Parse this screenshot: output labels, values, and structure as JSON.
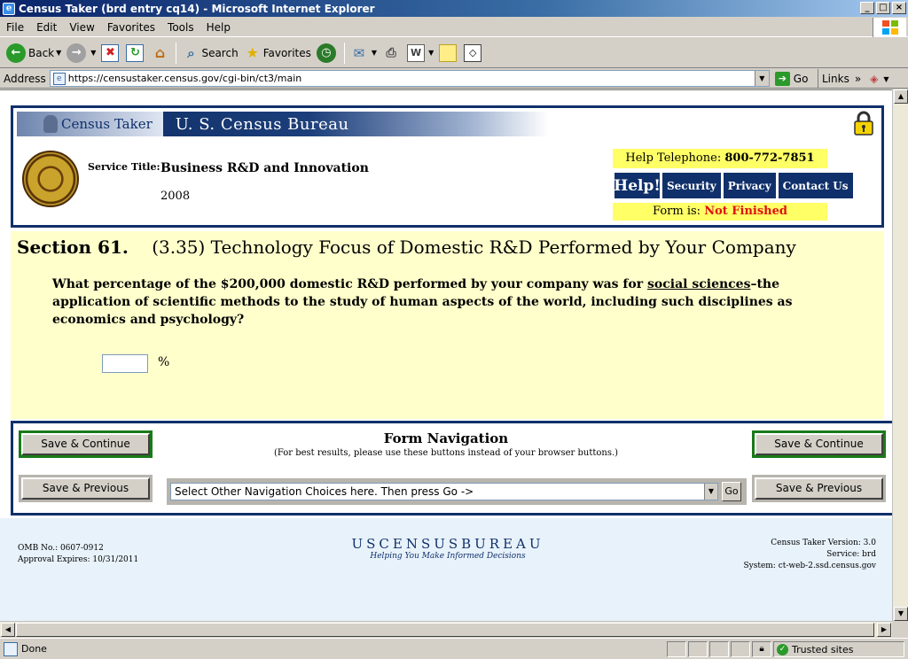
{
  "window": {
    "title": "Census Taker (brd entry cq14) - Microsoft Internet Explorer",
    "minimize": "_",
    "maximize": "□",
    "close": "×"
  },
  "menu": [
    "File",
    "Edit",
    "View",
    "Favorites",
    "Tools",
    "Help"
  ],
  "toolbar": {
    "back": "Back",
    "search": "Search",
    "favorites": "Favorites"
  },
  "address": {
    "label": "Address",
    "url": "https://censustaker.census.gov/cgi-bin/ct3/main",
    "go": "Go",
    "links": "Links"
  },
  "header": {
    "census_taker": "Census Taker",
    "bureau": "U. S. Census Bureau",
    "service_label": "Service Title:",
    "service_title": "Business R&D and Innovation",
    "year": "2008",
    "help_tel_label": "Help Telephone:",
    "help_tel": "800-772-7851",
    "nav": [
      "Help!",
      "Security",
      "Privacy",
      "Contact Us"
    ],
    "form_is_label": "Form is:",
    "form_status": "Not Finished"
  },
  "section": {
    "number": "Section 61.",
    "title": "(3.35) Technology Focus of Domestic R&D Performed by Your Company",
    "question_pre": "What percentage of the $200,000 domestic R&D performed by your company was for ",
    "question_link": "social sciences",
    "question_post": "–the application of scientific methods to the study of human aspects of the world, including such disciplines as economics and psychology?",
    "input_value": "",
    "unit": "%"
  },
  "form_nav": {
    "title": "Form Navigation",
    "subtitle": "(For best results, please use these buttons instead of your browser buttons.)",
    "save_continue": "Save & Continue",
    "save_previous": "Save & Previous",
    "select_text": "Select Other Navigation Choices here. Then press Go ->",
    "go": "Go"
  },
  "footer": {
    "omb": "OMB No.: 0607-0912",
    "approval": "Approval Expires: 10/31/2011",
    "logo": "USCENSUSBUREAU",
    "tagline": "Helping You Make Informed Decisions",
    "version": "Census Taker Version: 3.0",
    "service": "Service: brd",
    "system": "System: ct-web-2.ssd.census.gov"
  },
  "status": {
    "text": "Done",
    "zone": "Trusted sites"
  }
}
